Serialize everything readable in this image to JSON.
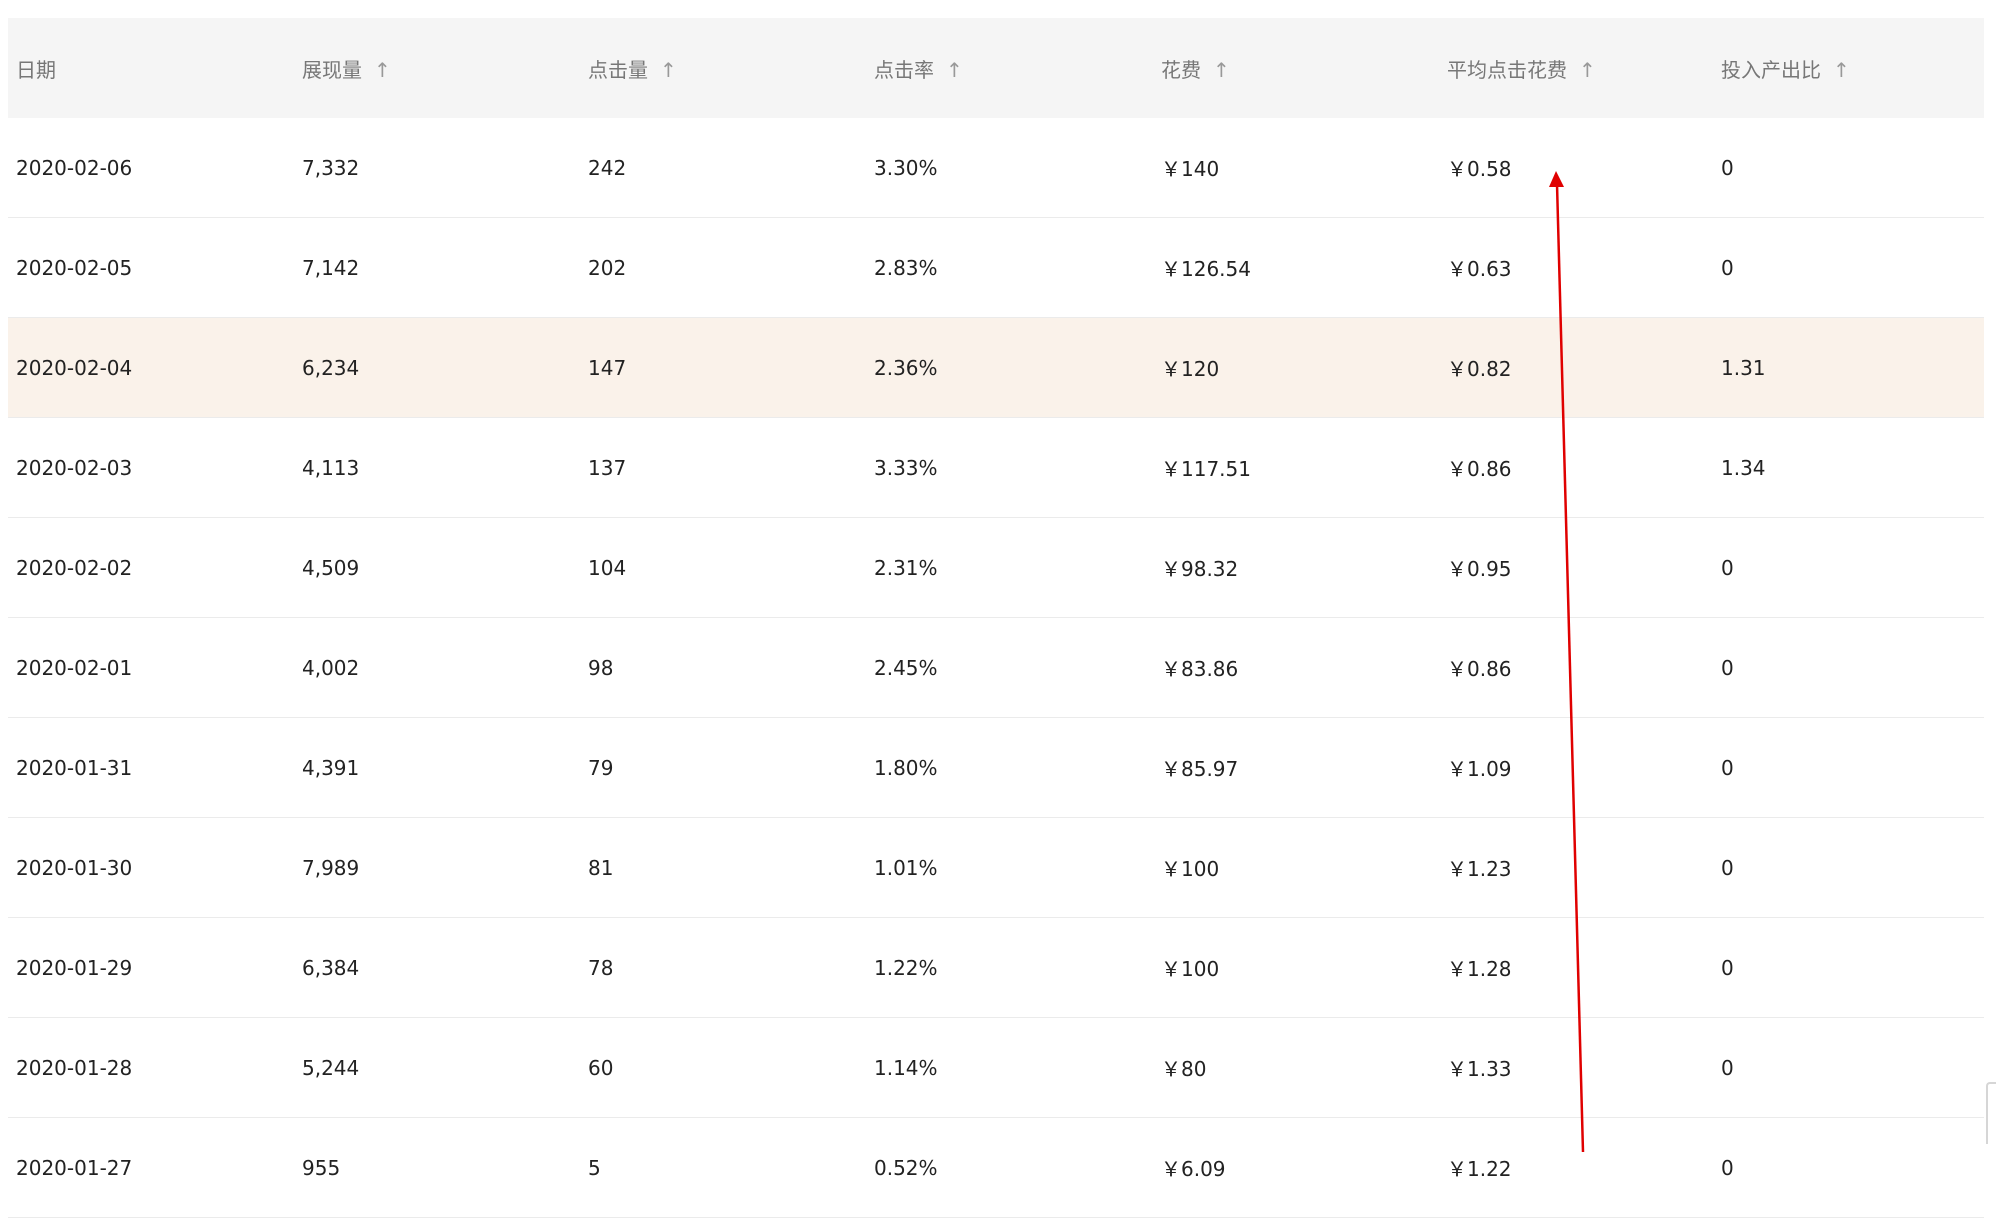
{
  "table": {
    "headers": [
      {
        "label": "日期",
        "sortable": false
      },
      {
        "label": "展现量",
        "sortable": true
      },
      {
        "label": "点击量",
        "sortable": true
      },
      {
        "label": "点击率",
        "sortable": true
      },
      {
        "label": "花费",
        "sortable": true
      },
      {
        "label": "平均点击花费",
        "sortable": true
      },
      {
        "label": "投入产出比",
        "sortable": true
      }
    ],
    "sort_icon": "arrow-up-icon",
    "sort_glyph": "↑",
    "rows": [
      {
        "date": "2020-02-06",
        "impressions": "7,332",
        "clicks": "242",
        "ctr": "3.30%",
        "cost": "￥140",
        "avg_cpc": "￥0.58",
        "roi": "0",
        "highlighted": false
      },
      {
        "date": "2020-02-05",
        "impressions": "7,142",
        "clicks": "202",
        "ctr": "2.83%",
        "cost": "￥126.54",
        "avg_cpc": "￥0.63",
        "roi": "0",
        "highlighted": false
      },
      {
        "date": "2020-02-04",
        "impressions": "6,234",
        "clicks": "147",
        "ctr": "2.36%",
        "cost": "￥120",
        "avg_cpc": "￥0.82",
        "roi": "1.31",
        "highlighted": true
      },
      {
        "date": "2020-02-03",
        "impressions": "4,113",
        "clicks": "137",
        "ctr": "3.33%",
        "cost": "￥117.51",
        "avg_cpc": "￥0.86",
        "roi": "1.34",
        "highlighted": false
      },
      {
        "date": "2020-02-02",
        "impressions": "4,509",
        "clicks": "104",
        "ctr": "2.31%",
        "cost": "￥98.32",
        "avg_cpc": "￥0.95",
        "roi": "0",
        "highlighted": false
      },
      {
        "date": "2020-02-01",
        "impressions": "4,002",
        "clicks": "98",
        "ctr": "2.45%",
        "cost": "￥83.86",
        "avg_cpc": "￥0.86",
        "roi": "0",
        "highlighted": false
      },
      {
        "date": "2020-01-31",
        "impressions": "4,391",
        "clicks": "79",
        "ctr": "1.80%",
        "cost": "￥85.97",
        "avg_cpc": "￥1.09",
        "roi": "0",
        "highlighted": false
      },
      {
        "date": "2020-01-30",
        "impressions": "7,989",
        "clicks": "81",
        "ctr": "1.01%",
        "cost": "￥100",
        "avg_cpc": "￥1.23",
        "roi": "0",
        "highlighted": false
      },
      {
        "date": "2020-01-29",
        "impressions": "6,384",
        "clicks": "78",
        "ctr": "1.22%",
        "cost": "￥100",
        "avg_cpc": "￥1.28",
        "roi": "0",
        "highlighted": false
      },
      {
        "date": "2020-01-28",
        "impressions": "5,244",
        "clicks": "60",
        "ctr": "1.14%",
        "cost": "￥80",
        "avg_cpc": "￥1.33",
        "roi": "0",
        "highlighted": false
      },
      {
        "date": "2020-01-27",
        "impressions": "955",
        "clicks": "5",
        "ctr": "0.52%",
        "cost": "￥6.09",
        "avg_cpc": "￥1.22",
        "roi": "0",
        "highlighted": false
      }
    ]
  },
  "annotation": {
    "type": "arrow",
    "color": "#e00000",
    "meaning": "trend-up-arrow"
  },
  "colors": {
    "header_bg": "#f5f5f5",
    "highlight_row_bg": "#faf2ea",
    "arrow": "#e00000"
  }
}
